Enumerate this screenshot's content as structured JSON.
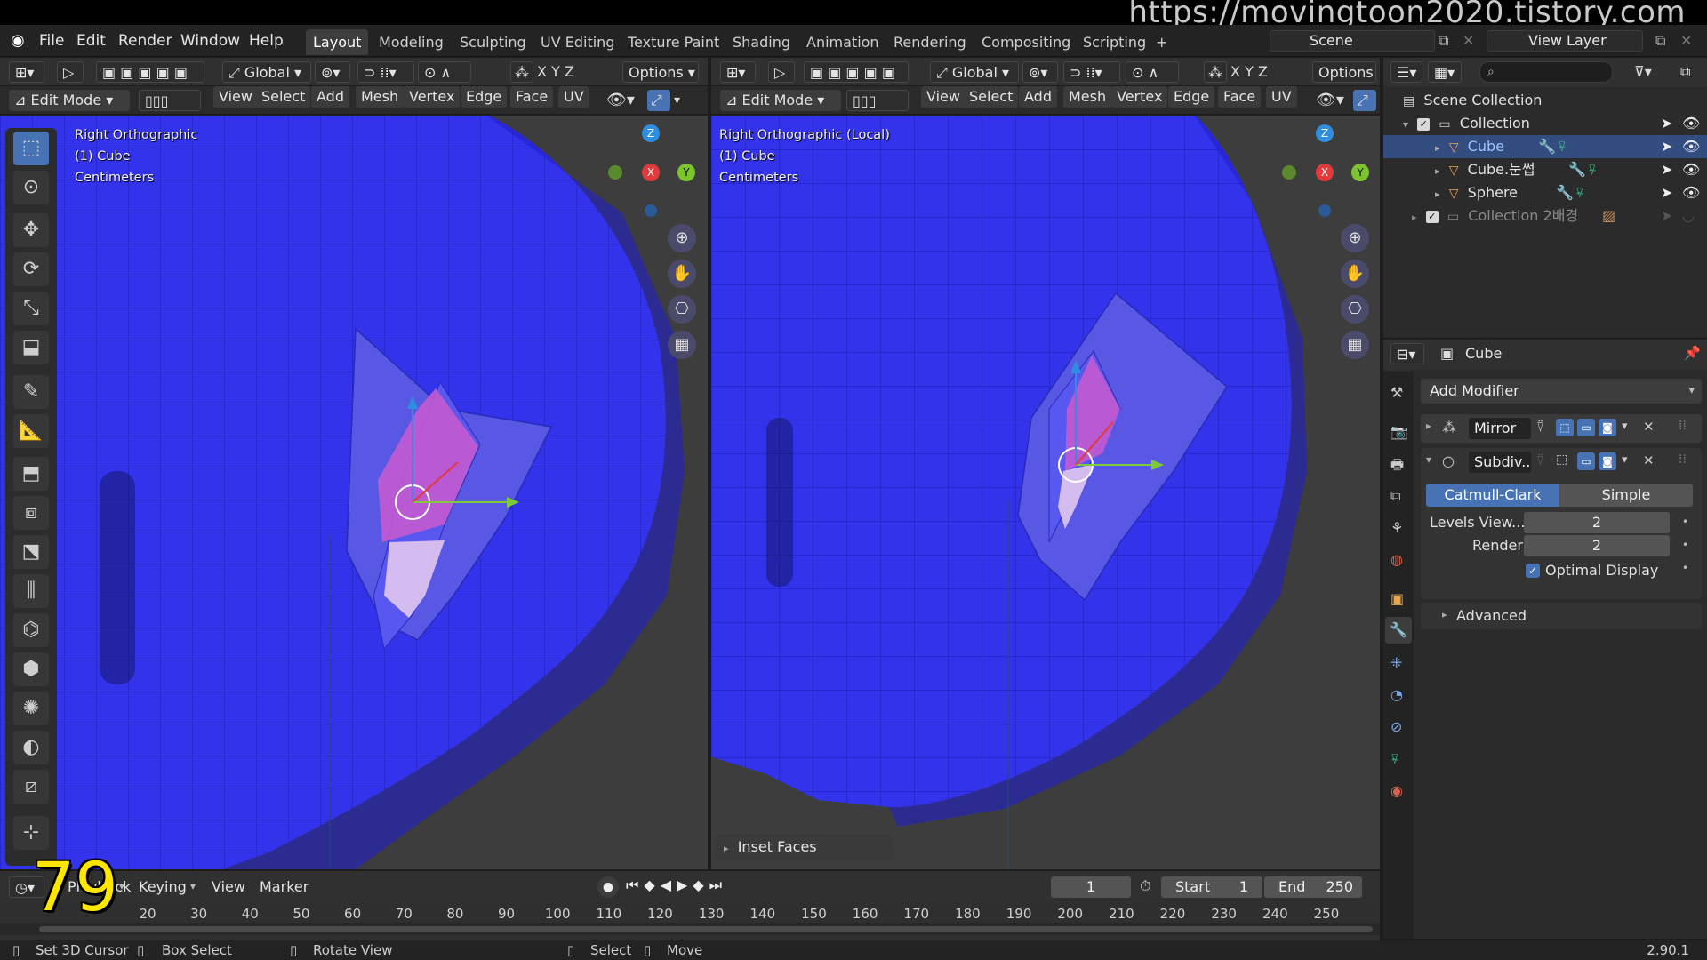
{
  "watermark": "https://movingtoon2020.tistory.com",
  "menu": [
    "File",
    "Edit",
    "Render",
    "Window",
    "Help"
  ],
  "workspaces": [
    "Layout",
    "Modeling",
    "Sculpting",
    "UV Editing",
    "Texture Paint",
    "Shading",
    "Animation",
    "Rendering",
    "Compositing",
    "Scripting"
  ],
  "active_workspace": "Layout",
  "scene": {
    "label": "Scene",
    "view_layer": "View Layer"
  },
  "viewport_left": {
    "orientation": "Global",
    "options": "Options",
    "mode": "Edit Mode",
    "menus": [
      "View",
      "Select",
      "Add",
      "Mesh",
      "Vertex",
      "Edge",
      "Face",
      "UV"
    ],
    "axes": [
      "X",
      "Y",
      "Z"
    ],
    "info": [
      "Right Orthographic",
      "(1) Cube",
      "Centimeters"
    ]
  },
  "viewport_right": {
    "orientation": "Global",
    "options": "Options",
    "mode": "Edit Mode",
    "menus": [
      "View",
      "Select",
      "Add",
      "Mesh",
      "Vertex",
      "Edge",
      "Face",
      "UV"
    ],
    "axes": [
      "X",
      "Y",
      "Z"
    ],
    "info": [
      "Right Orthographic (Local)",
      "(1) Cube",
      "Centimeters"
    ],
    "last_operator": "Inset Faces"
  },
  "gizmo": {
    "z": "Z",
    "x": "X",
    "y": "Y",
    "colors": {
      "x": "#e03a3a",
      "y": "#7cc42c",
      "z": "#2f8ee0"
    }
  },
  "outliner": {
    "root": "Scene Collection",
    "items": [
      {
        "name": "Collection",
        "selected": false
      },
      {
        "name": "Cube",
        "selected": true
      },
      {
        "name": "Cube.눈썹",
        "selected": false
      },
      {
        "name": "Sphere",
        "selected": false
      },
      {
        "name": "Collection 2배경",
        "selected": false
      }
    ]
  },
  "properties": {
    "object": "Cube",
    "add_modifier": "Add Modifier",
    "modifiers": [
      "Mirror",
      "Subdiv..."
    ],
    "subdiv_modes": [
      "Catmull-Clark",
      "Simple"
    ],
    "levels_view_label": "Levels View...",
    "levels_view": "2",
    "render_label": "Render",
    "render": "2",
    "optimal_display": "Optimal Display",
    "advanced": "Advanced"
  },
  "timeline": {
    "overlay_number": "79",
    "menus": [
      "Playback",
      "Keying",
      "View",
      "Marker"
    ],
    "current_frame": "1",
    "start_label": "Start",
    "start": "1",
    "end_label": "End",
    "end": "250",
    "ticks": [
      "20",
      "30",
      "40",
      "50",
      "60",
      "70",
      "80",
      "90",
      "100",
      "110",
      "120",
      "130",
      "140",
      "150",
      "160",
      "170",
      "180",
      "190",
      "200",
      "210",
      "220",
      "230",
      "240",
      "250"
    ]
  },
  "status": {
    "items": [
      "Set 3D Cursor",
      "Box Select",
      "Rotate View",
      "Select",
      "Move"
    ],
    "version": "2.90.1"
  },
  "colors": {
    "accent": "#4772b3",
    "mesh": "#2a2aee",
    "selection": "#c45ad0"
  }
}
